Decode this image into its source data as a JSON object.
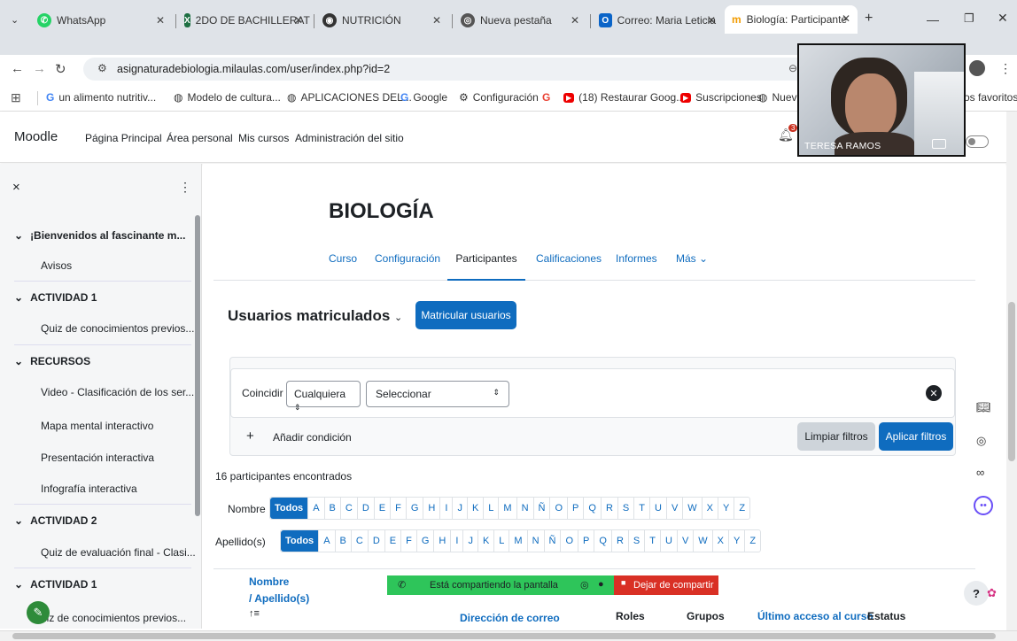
{
  "browser": {
    "tabs": [
      {
        "title": "WhatsApp"
      },
      {
        "title": "2DO DE BACHILLERAT"
      },
      {
        "title": "NUTRICIÓN"
      },
      {
        "title": "Nueva pestaña"
      },
      {
        "title": "Correo: Maria Leticia"
      },
      {
        "title": "Biología: Participante"
      }
    ],
    "url": "asignaturadebiologia.milaulas.com/user/index.php?id=2",
    "bookmarks": [
      "un alimento nutritiv...",
      "Modelo de cultura...",
      "APLICACIONES DEL...",
      "Google",
      "Configuración",
      "(18) Restaurar Goog...",
      "Suscripciones",
      "Nueva",
      "os favoritos"
    ],
    "notification_count": "3"
  },
  "moodle": {
    "brand": "Moodle",
    "nav": [
      "Página Principal",
      "Área personal",
      "Mis cursos",
      "Administración del sitio"
    ]
  },
  "webcam": {
    "name": "TERESA RAMOS"
  },
  "sidebar": {
    "close": "×",
    "more": "⋮",
    "sections": [
      {
        "label": "¡Bienvenidos al fascinante m..."
      },
      {
        "label": "ACTIVIDAD 1"
      },
      {
        "label": "RECURSOS"
      },
      {
        "label": "ACTIVIDAD 2"
      },
      {
        "label": "ACTIVIDAD 1"
      }
    ],
    "items": [
      "Avisos",
      "Quiz de conocimientos previos...",
      "Video - Clasificación de los ser...",
      "Mapa mental interactivo",
      "Presentación interactiva",
      "Infografía interactiva",
      "Quiz de evaluación final - Clasi...",
      "uiz de conocimientos previos..."
    ]
  },
  "course": {
    "title": "BIOLOGÍA",
    "tabs": [
      "Curso",
      "Configuración",
      "Participantes",
      "Calificaciones",
      "Informes",
      "Más"
    ]
  },
  "participants": {
    "heading": "Usuarios matriculados",
    "enrol_button": "Matricular usuarios",
    "filter": {
      "match_label": "Coincidir",
      "match_value": "Cualquiera",
      "select_value": "Seleccionar",
      "add_condition": "Añadir condición",
      "clear": "Limpiar filtros",
      "apply": "Aplicar filtros"
    },
    "count_text": "16 participantes encontrados",
    "first_name_label": "Nombre",
    "last_name_label": "Apellido(s)",
    "all_label": "Todos",
    "letters": [
      "A",
      "B",
      "C",
      "D",
      "E",
      "F",
      "G",
      "H",
      "I",
      "J",
      "K",
      "L",
      "M",
      "N",
      "Ñ",
      "O",
      "P",
      "Q",
      "R",
      "S",
      "T",
      "U",
      "V",
      "W",
      "X",
      "Y",
      "Z"
    ],
    "columns": {
      "name": "Nombre",
      "surname": "/ Apellido(s)",
      "email": "Dirección de correo",
      "roles": "Roles",
      "groups": "Grupos",
      "last_access": "Último acceso al curso",
      "status": "Estatus"
    }
  },
  "share_bar": {
    "sharing_text": "Está compartiendo la pantalla",
    "stop_text": "Dejar de compartir"
  },
  "help": "?",
  "colors": {
    "accent": "#0f6cbf",
    "share_green": "#2ec55a",
    "share_red": "#d93025"
  }
}
